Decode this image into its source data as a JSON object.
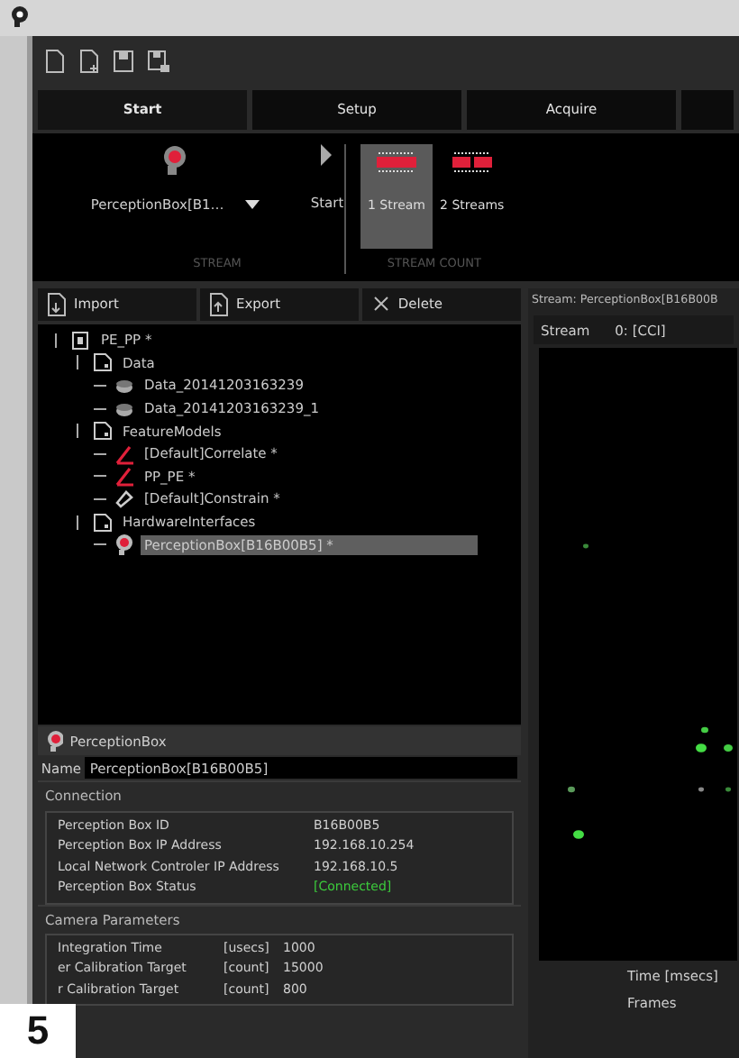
{
  "tabs": [
    {
      "label": "Start",
      "selected": true
    },
    {
      "label": "Setup",
      "selected": false
    },
    {
      "label": "Acquire",
      "selected": false
    }
  ],
  "ribbon": {
    "stream": {
      "device": "PerceptionBox[B1…",
      "start": "Start",
      "caption": "STREAM"
    },
    "stream_count": {
      "options": [
        {
          "label": "1 Stream",
          "selected": true
        },
        {
          "label": "2 Streams",
          "selected": false
        }
      ],
      "caption": "STREAM COUNT"
    }
  },
  "tree_toolbar": [
    {
      "label": "Import",
      "kind": "import"
    },
    {
      "label": "Export",
      "kind": "export"
    },
    {
      "label": "Delete",
      "kind": "delete"
    }
  ],
  "tree": [
    {
      "label": "PE_PP *",
      "kind": "project",
      "selected": false,
      "children": [
        {
          "label": "Data",
          "kind": "folder",
          "selected": false,
          "children": [
            {
              "label": "Data_20141203163239",
              "kind": "data",
              "selected": false
            },
            {
              "label": "Data_20141203163239_1",
              "kind": "data",
              "selected": false
            }
          ]
        },
        {
          "label": "FeatureModels",
          "kind": "folder",
          "selected": false,
          "children": [
            {
              "label": "[Default]Correlate *",
              "kind": "feature",
              "selected": false
            },
            {
              "label": "PP_PE *",
              "kind": "feature",
              "selected": false
            },
            {
              "label": "[Default]Constrain *",
              "kind": "constrain",
              "selected": false
            }
          ]
        },
        {
          "label": "HardwareInterfaces",
          "kind": "folder",
          "selected": false,
          "children": [
            {
              "label": "PerceptionBox[B16B00B5] *",
              "kind": "device",
              "selected": true
            }
          ]
        }
      ]
    }
  ],
  "properties": {
    "title": "PerceptionBox",
    "name_label": "Name",
    "name_value": "PerceptionBox[B16B00B5]",
    "sections": [
      {
        "title": "Connection",
        "rows": [
          {
            "label": "Perception Box ID",
            "value": "B16B00B5",
            "kind": "plain"
          },
          {
            "label": "Perception Box IP Address",
            "value": "192.168.10.254",
            "kind": "plain"
          },
          {
            "label": "Local Network Controler IP Address",
            "value": "192.168.10.5",
            "kind": "plain"
          },
          {
            "label": "Perception Box Status",
            "value": "[Connected]",
            "kind": "status"
          }
        ]
      },
      {
        "title": "Camera Parameters",
        "rows": [
          {
            "label": "Integration Time",
            "unit": "[usecs]",
            "value": "1000",
            "kind": "plain"
          },
          {
            "label": "er Calibration Target",
            "unit": "[count]",
            "value": "15000",
            "kind": "plain"
          },
          {
            "label": "r Calibration Target",
            "unit": "[count]",
            "value": "800",
            "kind": "plain"
          }
        ]
      }
    ]
  },
  "stream_view": {
    "title": "Stream: PerceptionBox[B16B00B",
    "stream_label": "Stream",
    "stream_value": "0: [CCI]",
    "time_label": "Time [msecs]",
    "frames_label": "Frames"
  },
  "figure_label": "5"
}
